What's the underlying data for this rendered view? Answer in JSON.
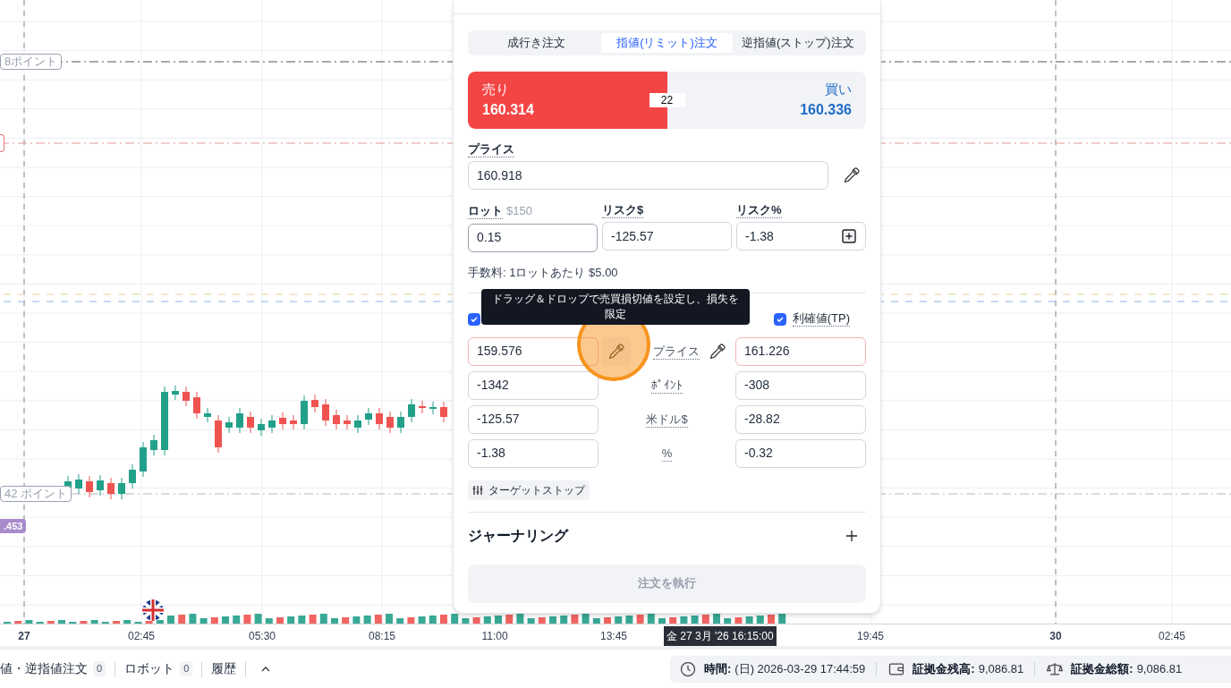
{
  "chart": {
    "level_labels": [
      {
        "kind": "outline",
        "text": "8ポイント"
      },
      {
        "kind": "red-edge"
      },
      {
        "kind": "outline",
        "text": "42 ポイント"
      },
      {
        "kind": "badge",
        "text": ".453"
      }
    ],
    "x_axis": [
      {
        "label": "27",
        "bold": true
      },
      {
        "label": "02:45",
        "bold": false
      },
      {
        "label": "05:30",
        "bold": false
      },
      {
        "label": "08:15",
        "bold": false
      },
      {
        "label": "11:00",
        "bold": false
      },
      {
        "label": "13:45",
        "bold": false
      },
      {
        "label": "19:45",
        "bold": false
      },
      {
        "label": "30",
        "bold": true
      },
      {
        "label": "02:45",
        "bold": false
      }
    ],
    "crosshair_label": "金 27 3月 '26 16:15:00"
  },
  "order_panel": {
    "tabs": [
      {
        "label": "成行き注文",
        "selected": false
      },
      {
        "label": "指値(リミット)注文",
        "selected": true
      },
      {
        "label": "逆指値(ストップ)注文",
        "selected": false
      }
    ],
    "sell": {
      "label": "売り",
      "price": "160.314",
      "level": 0.5
    },
    "spread": "22",
    "buy": {
      "label": "買い",
      "price": "160.336"
    },
    "price": {
      "label": "プライス",
      "value": "160.918"
    },
    "sizing": [
      {
        "label": "ロット",
        "hint": "$150",
        "value": "0.15"
      },
      {
        "label": "リスク$",
        "value": "-125.57"
      },
      {
        "label": "リスク%",
        "value": "-1.38"
      }
    ],
    "fee": "手数料: 1ロットあたり $5.00",
    "tooltip": "ドラッグ＆ドロップで売買損切値を設定し、損失を限定",
    "stop_loss": {
      "checked": true,
      "values": [
        "159.576",
        "-1342",
        "-125.57",
        "-1.38"
      ]
    },
    "take_profit": {
      "label": "利確値(TP)",
      "checked": true,
      "values": [
        "161.226",
        "-308",
        "-28.82",
        "-0.32"
      ]
    },
    "row_labels": [
      "プライス",
      "ﾎﾟｲﾝﾄ",
      "米ドル$",
      "%"
    ],
    "target_stop": "ターゲットストップ",
    "journaling": "ジャーナリング",
    "submit": {
      "label": "注文を執行",
      "disabled": true
    }
  },
  "bottom_bar": {
    "tabs": [
      {
        "label": "値・逆指値注文",
        "count": "0"
      },
      {
        "label": "ロボット",
        "count": "0"
      },
      {
        "label": "履歴"
      }
    ],
    "status": [
      {
        "kind": "clock",
        "label": "時間:",
        "value": "(日) 2026-03-29 17:44:59"
      },
      {
        "kind": "wallet",
        "label": "証拠金残高:",
        "value": "9,086.81"
      },
      {
        "kind": "scale",
        "label": "証拠金総額:",
        "value": "9,086.81"
      }
    ]
  }
}
